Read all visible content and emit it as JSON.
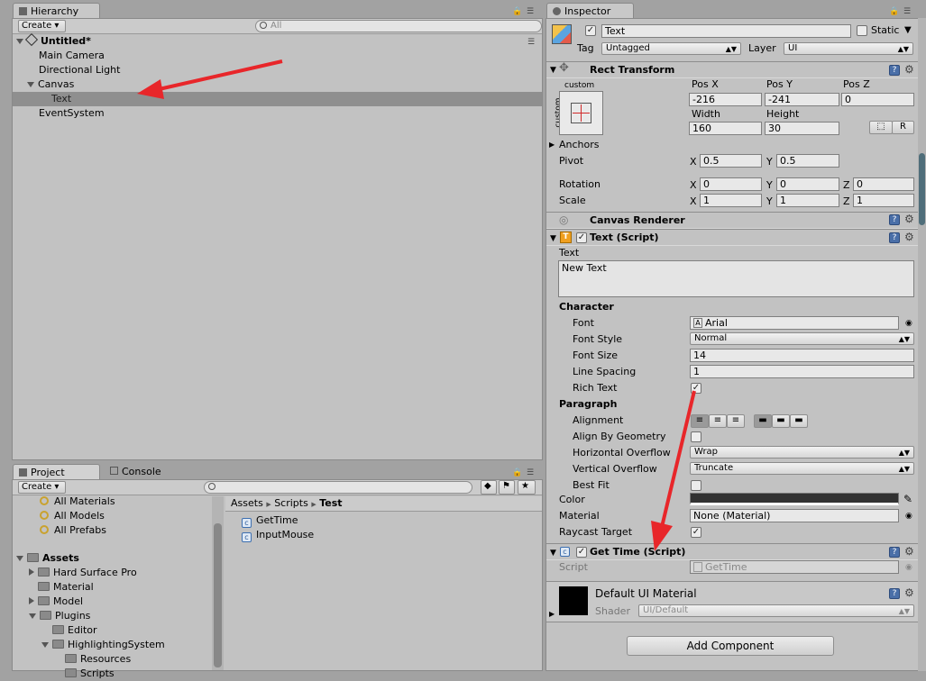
{
  "hierarchy": {
    "tab": "Hierarchy",
    "create": "Create",
    "search_placeholder": "All",
    "scene": "Untitled*",
    "items": [
      "Main Camera",
      "Directional Light",
      "Canvas",
      "Text",
      "EventSystem"
    ]
  },
  "project": {
    "tab_project": "Project",
    "tab_console": "Console",
    "create": "Create",
    "favorites": [
      "All Materials",
      "All Models",
      "All Prefabs"
    ],
    "assets_root": "Assets",
    "tree": [
      "Hard Surface Pro",
      "Material",
      "Model",
      "Plugins",
      "Editor",
      "HighlightingSystem",
      "Resources",
      "Scripts"
    ],
    "breadcrumb": [
      "Assets",
      "Scripts",
      "Test"
    ],
    "files": [
      "GetTime",
      "InputMouse"
    ]
  },
  "inspector": {
    "tab": "Inspector",
    "object_name": "Text",
    "static_label": "Static",
    "tag_label": "Tag",
    "tag_value": "Untagged",
    "layer_label": "Layer",
    "layer_value": "UI",
    "rect_transform": {
      "title": "Rect Transform",
      "anchor_preset": "custom",
      "anchor_side": "custom",
      "posx_label": "Pos X",
      "posy_label": "Pos Y",
      "posz_label": "Pos Z",
      "posx": "-216",
      "posy": "-241",
      "posz": "0",
      "width_label": "Width",
      "height_label": "Height",
      "width": "160",
      "height": "30",
      "r_button": "R",
      "anchors_label": "Anchors",
      "pivot_label": "Pivot",
      "pivot_x": "0.5",
      "pivot_y": "0.5",
      "rotation_label": "Rotation",
      "rot_x": "0",
      "rot_y": "0",
      "rot_z": "0",
      "scale_label": "Scale",
      "scale_x": "1",
      "scale_y": "1",
      "scale_z": "1",
      "x": "X",
      "y": "Y",
      "z": "Z"
    },
    "canvas_renderer": "Canvas Renderer",
    "text_script": {
      "title": "Text (Script)",
      "text_label": "Text",
      "text_value": "New Text",
      "character": "Character",
      "font_label": "Font",
      "font_value": "Arial",
      "font_style_label": "Font Style",
      "font_style_value": "Normal",
      "font_size_label": "Font Size",
      "font_size_value": "14",
      "line_spacing_label": "Line Spacing",
      "line_spacing_value": "1",
      "rich_text_label": "Rich Text",
      "paragraph": "Paragraph",
      "alignment_label": "Alignment",
      "align_geometry_label": "Align By Geometry",
      "h_overflow_label": "Horizontal Overflow",
      "h_overflow_value": "Wrap",
      "v_overflow_label": "Vertical Overflow",
      "v_overflow_value": "Truncate",
      "best_fit_label": "Best Fit",
      "color_label": "Color",
      "material_label": "Material",
      "material_value": "None (Material)",
      "raycast_label": "Raycast Target"
    },
    "get_time": {
      "title": "Get Time (Script)",
      "script_label": "Script",
      "script_value": "GetTime"
    },
    "material": {
      "name": "Default UI Material",
      "shader_label": "Shader",
      "shader_value": "UI/Default"
    },
    "add_component": "Add Component"
  },
  "colors": {
    "arrow": "#e8262a",
    "selection": "#8f8f8f"
  }
}
